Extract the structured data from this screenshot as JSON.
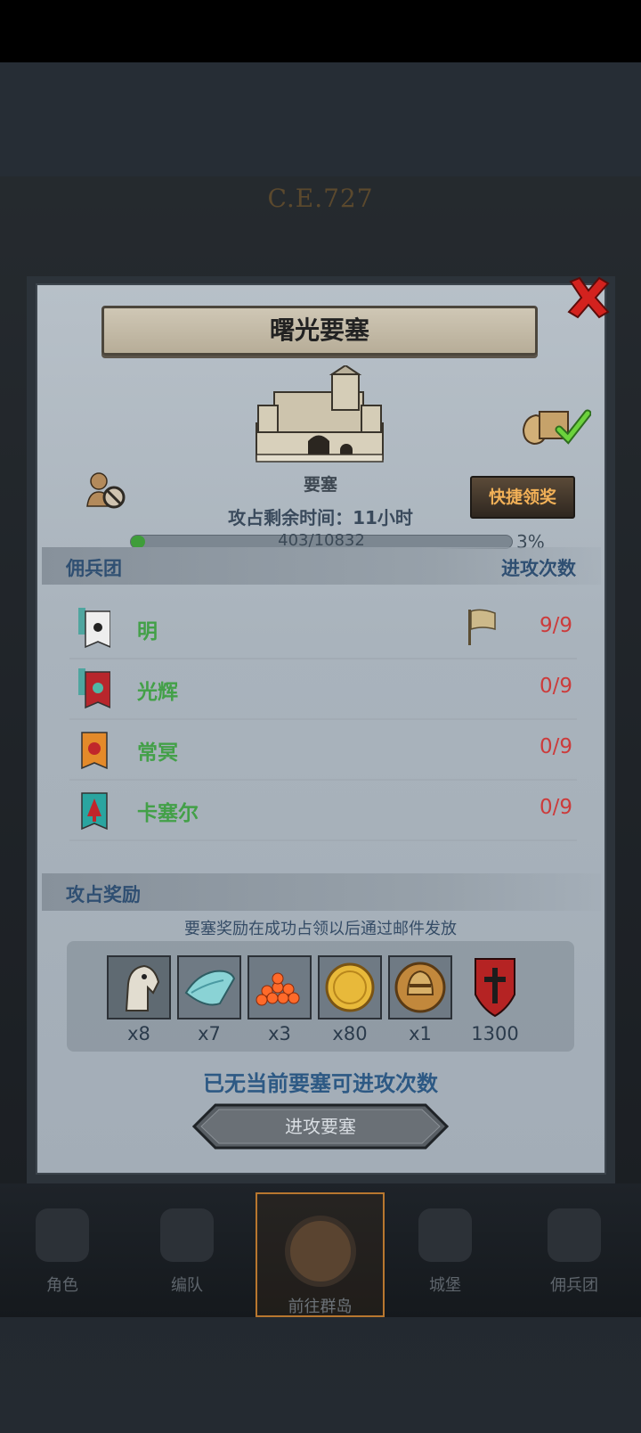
{
  "background": {
    "era": "C.E.727",
    "nav": [
      "角色",
      "编队",
      "前往群岛",
      "城堡",
      "佣兵团"
    ],
    "active_nav": "前往群岛"
  },
  "popup": {
    "title": "曙光要塞",
    "building_label": "要塞",
    "remaining_time": "攻占剩余时间：11小时",
    "quick_claim": "快捷领奖",
    "progress": {
      "current": 403,
      "total": 10832,
      "text": "403/10832",
      "percent_text": "3%"
    },
    "legion_header": "佣兵团",
    "attack_count_header": "进攻次数",
    "legions": [
      {
        "name": "明",
        "count": "9/9",
        "banner": "white-sun-banner",
        "flag": true
      },
      {
        "name": "光辉",
        "count": "0/9",
        "banner": "red-cross-banner",
        "flag": false
      },
      {
        "name": "常冥",
        "count": "0/9",
        "banner": "orange-sun-banner",
        "flag": false
      },
      {
        "name": "卡塞尔",
        "count": "0/9",
        "banner": "teal-tree-banner",
        "flag": false
      }
    ],
    "rewards_header": "攻占奖励",
    "rewards_notice": "要塞奖励在成功占领以后通过邮件发放",
    "rewards": [
      {
        "icon": "horse-icon",
        "qty": "x8"
      },
      {
        "icon": "cloth-icon",
        "qty": "x7"
      },
      {
        "icon": "roe-icon",
        "qty": "x3"
      },
      {
        "icon": "gold-coin-icon",
        "qty": "x80"
      },
      {
        "icon": "knight-helmet-icon",
        "qty": "x1"
      },
      {
        "icon": "legion-crest-icon",
        "qty": "1300"
      }
    ],
    "no_attempts_text": "已无当前要塞可进攻次数",
    "attack_button": "进攻要塞"
  }
}
